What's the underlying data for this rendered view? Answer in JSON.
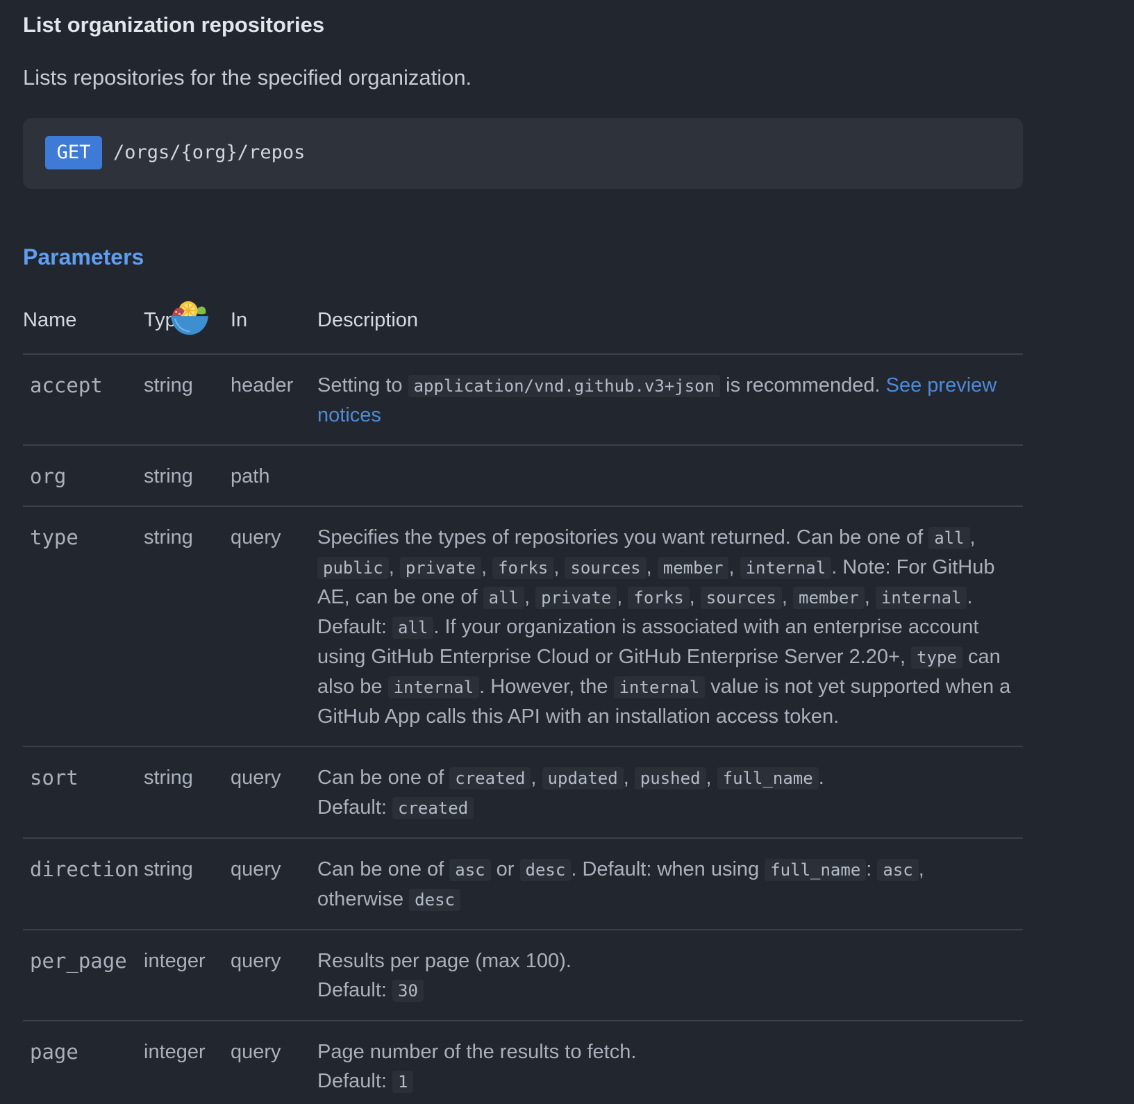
{
  "header": {
    "title": "List organization repositories",
    "description": "Lists repositories for the specified organization."
  },
  "endpoint": {
    "method": "GET",
    "path": "/orgs/{org}/repos"
  },
  "parameters": {
    "heading": "Parameters",
    "columns": {
      "name": "Name",
      "type": "Typ",
      "in": "In",
      "description": "Description"
    },
    "rows": {
      "accept": {
        "name": "accept",
        "type": "string",
        "in": "header",
        "desc": {
          "t1": "Setting to ",
          "c1": "application/vnd.github.v3+json",
          "t2": " is recommended. ",
          "link": "See preview notices"
        }
      },
      "org": {
        "name": "org",
        "type": "string",
        "in": "path"
      },
      "type": {
        "name": "type",
        "type": "string",
        "in": "query",
        "desc": {
          "t1": "Specifies the types of repositories you want returned. Can be one of ",
          "c1": "all",
          "c2": "public",
          "c3": "private",
          "c4": "forks",
          "c5": "sources",
          "c6": "member",
          "c7": "internal",
          "t2": ". Note: For GitHub AE, can be one of ",
          "c8": "all",
          "c9": "private",
          "c10": "forks",
          "c11": "sources",
          "c12": "member",
          "c13": "internal",
          "t3": ". Default: ",
          "c14": "all",
          "t4": ". If your organization is associated with an enterprise account using GitHub Enterprise Cloud or GitHub Enterprise Server 2.20+, ",
          "c15": "type",
          "t5": " can also be ",
          "c16": "internal",
          "t6": ". However, the ",
          "c17": "internal",
          "t7": " value is not yet supported when a GitHub App calls this API with an installation access token."
        }
      },
      "sort": {
        "name": "sort",
        "type": "string",
        "in": "query",
        "desc": {
          "t1": "Can be one of ",
          "c1": "created",
          "c2": "updated",
          "c3": "pushed",
          "c4": "full_name",
          "t2": "Default: ",
          "c5": "created"
        }
      },
      "direction": {
        "name": "direction",
        "type": "string",
        "in": "query",
        "desc": {
          "t1": "Can be one of ",
          "c1": "asc",
          "t2": " or ",
          "c2": "desc",
          "t3": ". Default: when using ",
          "c3": "full_name",
          "t4": ": ",
          "c4": "asc",
          "t5": ", otherwise ",
          "c5": "desc"
        }
      },
      "per_page": {
        "name": "per_page",
        "type": "integer",
        "in": "query",
        "desc": {
          "t1": "Results per page (max 100).",
          "t2": "Default: ",
          "c1": "30"
        }
      },
      "page": {
        "name": "page",
        "type": "integer",
        "in": "query",
        "desc": {
          "t1": "Page number of the results to fetch.",
          "t2": "Default: ",
          "c1": "1"
        }
      }
    }
  },
  "icons": {
    "overlay": "salad-bowl-icon"
  },
  "colors": {
    "background": "#22262e",
    "method_badge": "#3e7ad6",
    "link": "#4f8ad8",
    "heading_accent": "#5f9ef0"
  }
}
